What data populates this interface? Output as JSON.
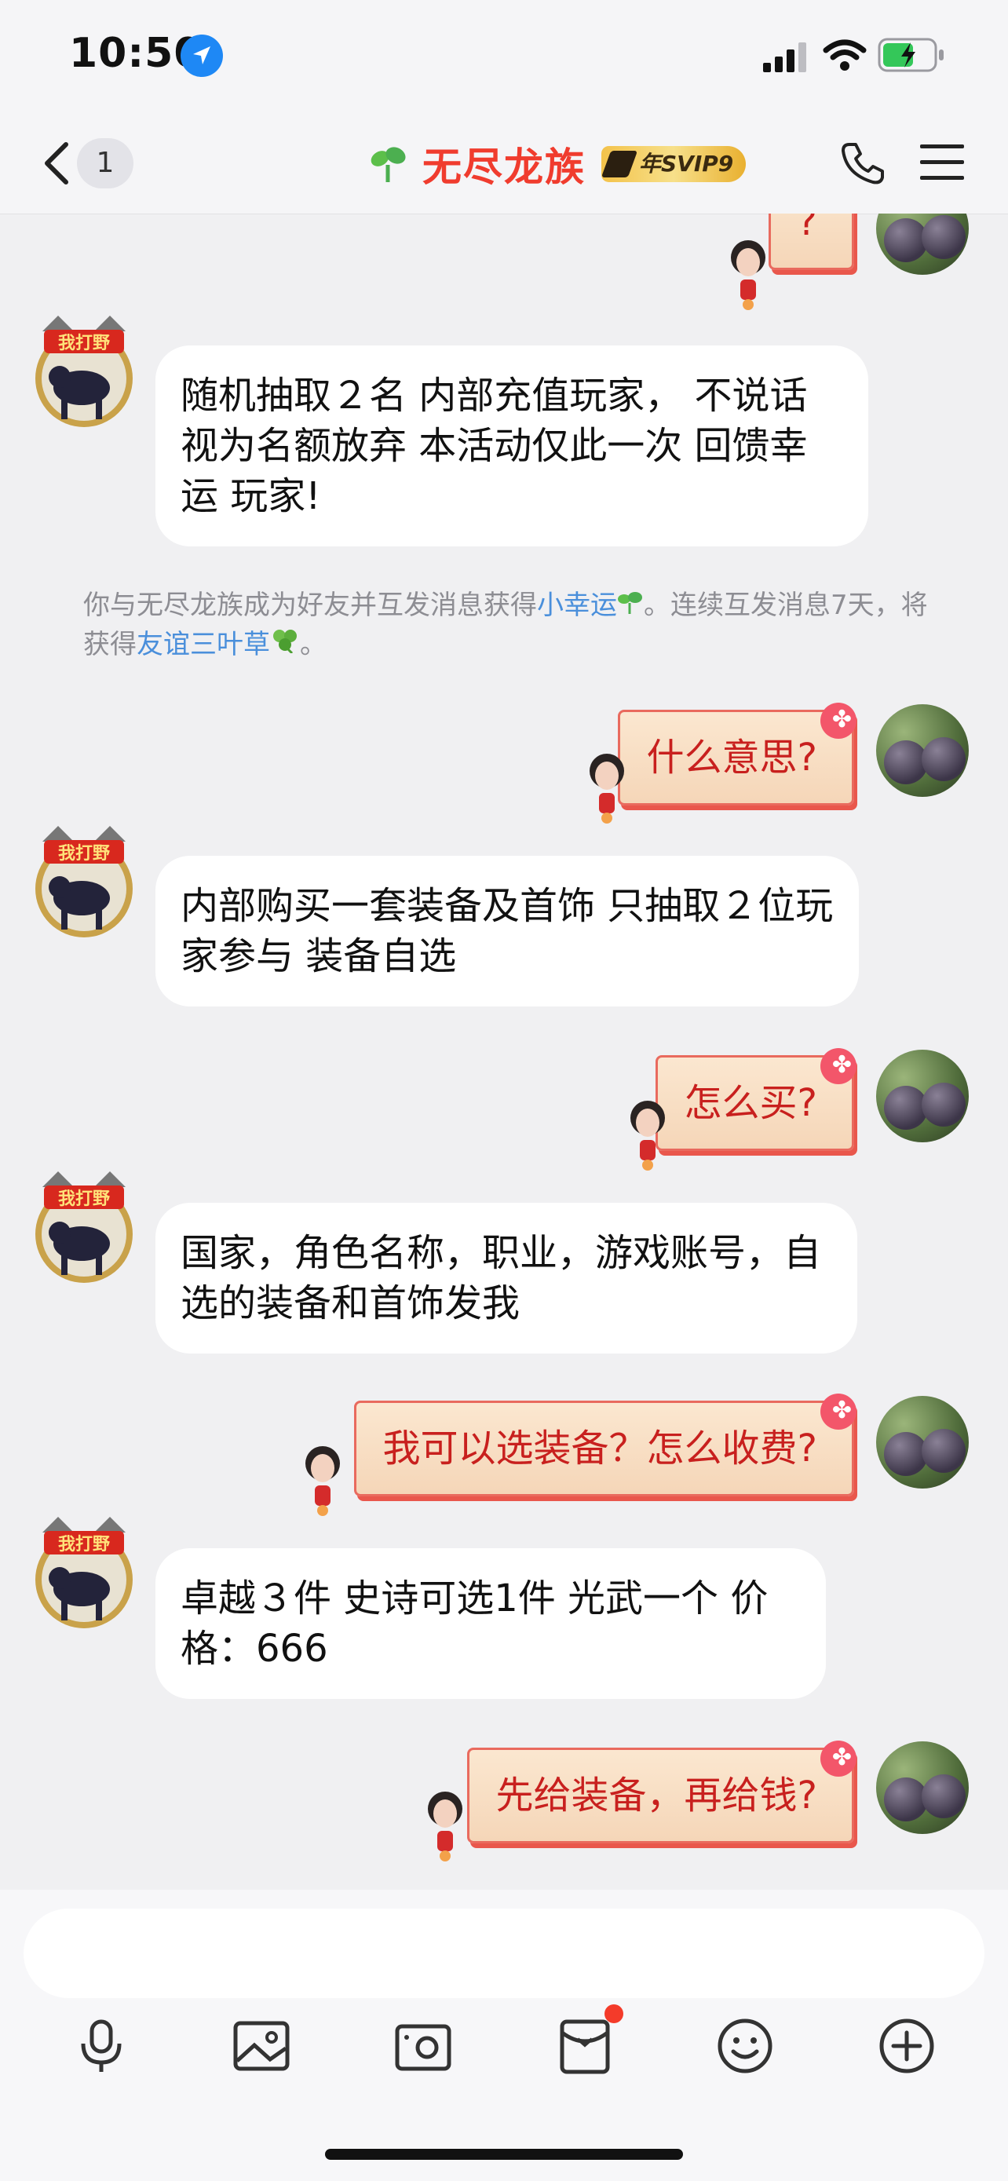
{
  "status_bar": {
    "time": "10:50"
  },
  "nav": {
    "unread_count": "1",
    "title": "无尽龙族",
    "vip_badge": "年SVIP9"
  },
  "messages": [
    {
      "side": "right",
      "text": "?"
    },
    {
      "side": "left",
      "text": "随机抽取２名 内部充值玩家， 不说话视为名额放弃  本活动仅此一次 回馈幸运 玩家!"
    },
    {
      "side": "right",
      "text": "什么意思?"
    },
    {
      "side": "left",
      "text": "内部购买一套装备及首饰 只抽取２位玩家参与 装备自选"
    },
    {
      "side": "right",
      "text": "怎么买?"
    },
    {
      "side": "left",
      "text": "国家，角色名称，职业，游戏账号，自选的装备和首饰发我"
    },
    {
      "side": "right",
      "text": "我可以选装备？怎么收费?"
    },
    {
      "side": "left",
      "text": "卓越３件 史诗可选1件 光武一个 价格：666"
    },
    {
      "side": "right",
      "text": "先给装备，再给钱?"
    }
  ],
  "system_note": {
    "prefix": "你与无尽龙族成为好友并互发消息获得",
    "link1": "小幸运",
    "middle": "。连续互发消息7天，将获得",
    "link2": "友谊三叶草",
    "suffix": "。"
  },
  "left_avatar_label": "我打野",
  "toolbar": [
    "microphone-icon",
    "image-icon",
    "camera-icon",
    "red-packet-icon",
    "emoji-icon",
    "plus-icon"
  ],
  "colors": {
    "title": "#f03c2e",
    "bubble_text_right": "#c8201e",
    "link": "#4a8fdb",
    "notification_dot": "#f43b2a"
  }
}
